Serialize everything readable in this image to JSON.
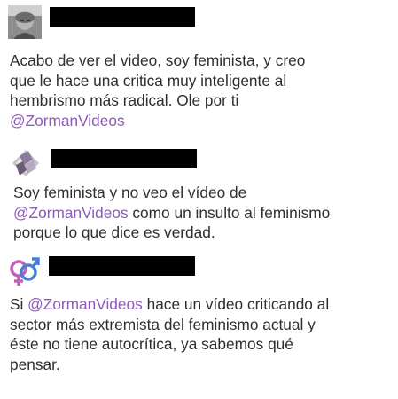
{
  "tweets": [
    {
      "avatar": "grayscale-photo-avatar",
      "username_redacted": true,
      "lines": [
        {
          "parts": [
            {
              "text": "Acabo de ver el video, soy feminista, y creo",
              "mention": false
            }
          ]
        },
        {
          "parts": [
            {
              "text": "que le hace una critica muy inteligente al",
              "mention": false
            }
          ]
        },
        {
          "parts": [
            {
              "text": "hembrismo más radical. Ole por ti",
              "mention": false
            }
          ]
        },
        {
          "parts": [
            {
              "text": "@ZormanVideos",
              "mention": true
            }
          ]
        }
      ]
    },
    {
      "avatar": "diamond-cards-avatar",
      "username_redacted": true,
      "lines": [
        {
          "parts": [
            {
              "text": "Soy feminista y no veo el vídeo de",
              "mention": false
            }
          ]
        },
        {
          "parts": [
            {
              "text": "@ZormanVideos",
              "mention": true
            },
            {
              "text": " como un insulto al feminismo",
              "mention": false
            }
          ]
        },
        {
          "parts": [
            {
              "text": "porque lo que dice es verdad.",
              "mention": false
            }
          ]
        }
      ]
    },
    {
      "avatar": "gender-symbols-avatar",
      "username_redacted": true,
      "lines": [
        {
          "parts": [
            {
              "text": "Si ",
              "mention": false
            },
            {
              "text": "@ZormanVideos",
              "mention": true
            },
            {
              "text": " hace un vídeo criticando al",
              "mention": false
            }
          ]
        },
        {
          "parts": [
            {
              "text": "sector más extremista del feminismo actual y",
              "mention": false
            }
          ]
        },
        {
          "parts": [
            {
              "text": "éste no tiene autocrítica, ya sabemos qué",
              "mention": false
            }
          ]
        },
        {
          "parts": [
            {
              "text": "pensar.",
              "mention": false
            }
          ]
        }
      ]
    }
  ],
  "colors": {
    "text": "#2e2e2e",
    "mention": "#8c5bb8",
    "redaction": "#000000",
    "background": "#ffffff"
  }
}
